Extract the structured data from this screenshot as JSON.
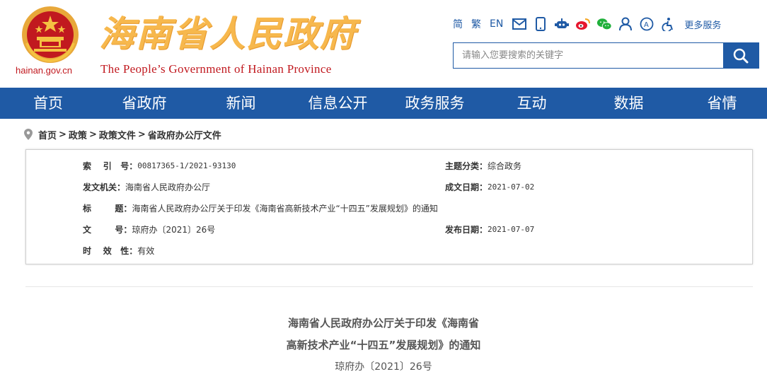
{
  "header": {
    "domain": "hainan.gov.cn",
    "title": "海南省人民政府",
    "subtitle": "The People’s Government  of Hainan Province"
  },
  "toolbar": {
    "lang_simplified": "简",
    "lang_traditional": "繁",
    "lang_english": "EN",
    "icons": [
      "mail-icon",
      "mobile-icon",
      "robot-icon",
      "weibo-icon",
      "wechat-icon",
      "user-icon",
      "accessibility-icon",
      "elderly-mode-icon"
    ],
    "more_services": "更多服务"
  },
  "search": {
    "placeholder": "请输入您要搜索的关键字"
  },
  "nav": {
    "items": [
      "首页",
      "省政府",
      "新闻",
      "信息公开",
      "政务服务",
      "互动",
      "数据",
      "省情"
    ]
  },
  "breadcrumb": {
    "items": [
      "首页",
      "政策",
      "政策文件",
      "省政府办公厅文件"
    ],
    "separator": ">"
  },
  "info": {
    "index_label": "索    引   号：",
    "index_value": "00817365-1/2021-93130",
    "topic_label": "主题分类：",
    "topic_value": "综合政务",
    "issuer_label": "发文机关：",
    "issuer_value": "海南省人民政府办公厅",
    "date_written_label": "成文日期：",
    "date_written_value": "2021-07-02",
    "title_label": "标        题：",
    "title_value": "海南省人民政府办公厅关于印发《海南省高新技术产业“十四五”发展规划》的通知",
    "docno_label": "文        号：",
    "docno_value": "琼府办〔2021〕26号",
    "date_pub_label": "发布日期：",
    "date_pub_value": "2021-07-07",
    "validity_label": "时    效   性：",
    "validity_value": "有效"
  },
  "document": {
    "title_line1": "海南省人民政府办公厅关于印发《海南省",
    "title_line2": "高新技术产业“十四五”发展规划》的通知",
    "number": "琼府办〔2021〕26号"
  },
  "colors": {
    "brand_blue": "#1f5aa5",
    "title_gold": "#f7b84d",
    "emblem_red": "#c1191f"
  }
}
